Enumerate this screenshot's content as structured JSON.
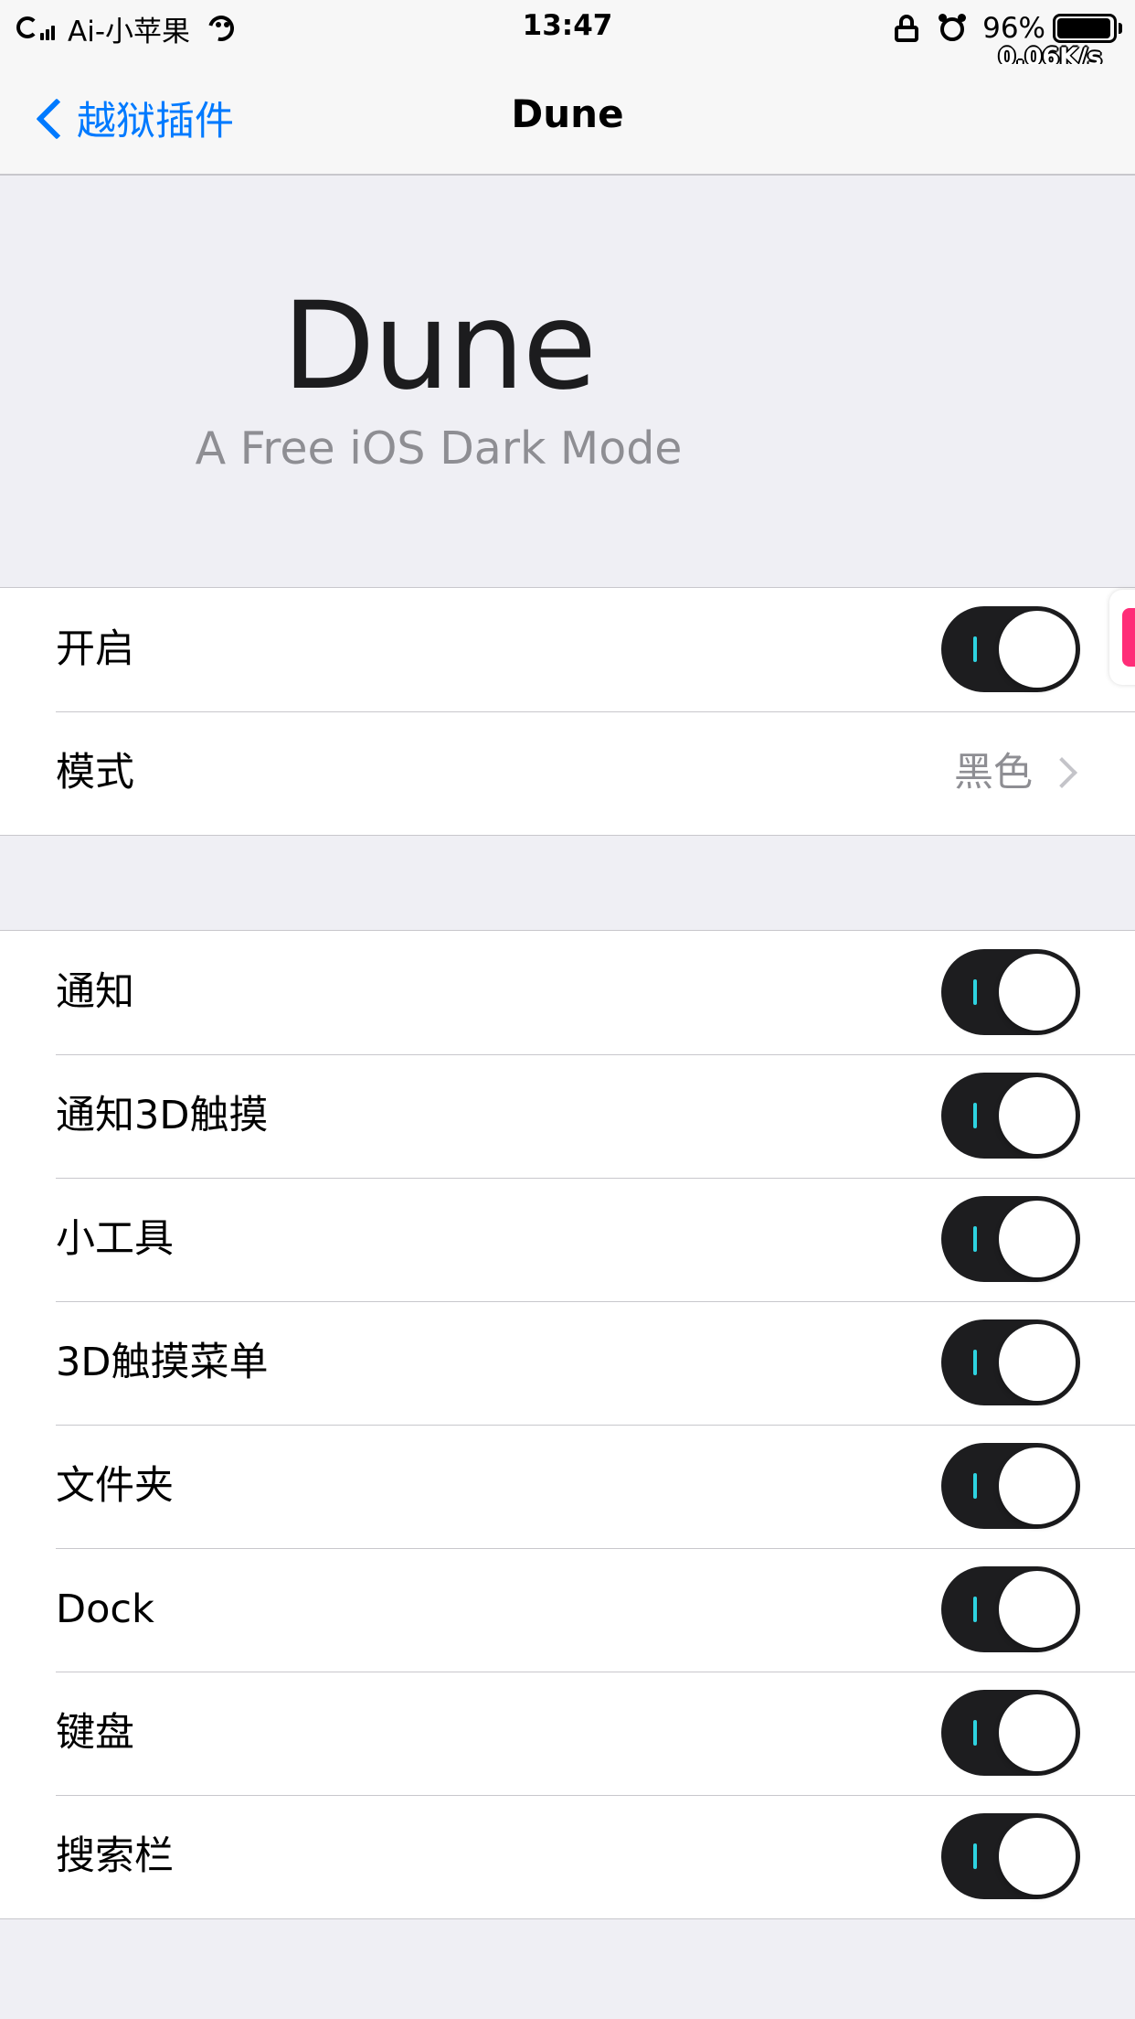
{
  "status_bar": {
    "carrier": "Ai-小苹果",
    "time": "13:47",
    "battery_percent": "96%",
    "battery_level": 0.96,
    "network_speed": "0.06K/s"
  },
  "nav": {
    "back_label": "越狱插件",
    "title": "Dune"
  },
  "header": {
    "title": "Dune",
    "subtitle": "A Free iOS Dark Mode"
  },
  "group1": {
    "rows": [
      {
        "label": "开启",
        "type": "toggle",
        "on": true
      },
      {
        "label": "模式",
        "type": "disclosure",
        "value": "黑色"
      }
    ]
  },
  "group2": {
    "rows": [
      {
        "label": "通知",
        "type": "toggle",
        "on": true
      },
      {
        "label": "通知3D触摸",
        "type": "toggle",
        "on": true
      },
      {
        "label": "小工具",
        "type": "toggle",
        "on": true
      },
      {
        "label": "3D触摸菜单",
        "type": "toggle",
        "on": true
      },
      {
        "label": "文件夹",
        "type": "toggle",
        "on": true
      },
      {
        "label": "Dock",
        "type": "toggle",
        "on": true
      },
      {
        "label": "键盘",
        "type": "toggle",
        "on": true
      },
      {
        "label": "搜索栏",
        "type": "toggle",
        "on": true
      }
    ]
  },
  "colors": {
    "accent": "#007aff",
    "toggle_on": "#1d1d1f",
    "toggle_tick": "#2ed3e0",
    "background": "#efeff4",
    "side_tab": "#ff2d78"
  }
}
